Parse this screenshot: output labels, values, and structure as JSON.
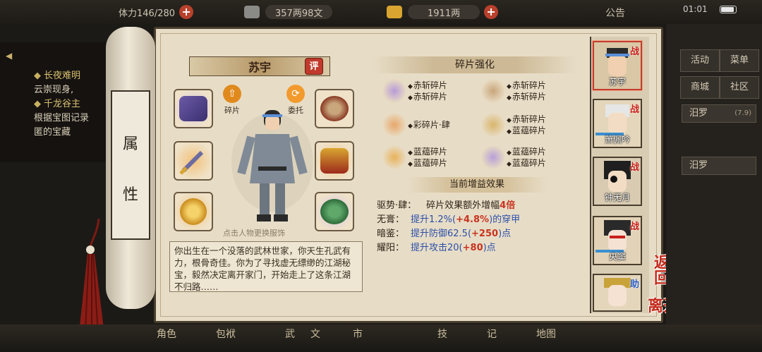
{
  "status_bar": {
    "stamina": "体力146/280",
    "silver": "357两98文",
    "gold": "1911两",
    "notice": "公告",
    "time": "01:01"
  },
  "quests": [
    {
      "title": "长夜难明",
      "desc": "云崇现身,"
    },
    {
      "title": "千龙谷主",
      "desc": "根据宝图记录",
      "desc2": "匿的宝藏"
    }
  ],
  "scroll_tab": {
    "chars": [
      "属",
      "性"
    ]
  },
  "character": {
    "name": "苏宇",
    "rate_button": "评",
    "hint": "点击人物更换服饰",
    "bio": "你出生在一个没落的武林世家，你天生孔武有力，根骨奇佳。你为了寻找虚无缥缈的江湖秘宝，毅然决定离开家门，开始走上了这条江湖不归路……"
  },
  "actions": [
    {
      "label": "碎片",
      "icon": "arrow-up-icon"
    },
    {
      "label": "委托",
      "icon": "refresh-icon"
    }
  ],
  "fragments": {
    "heading": "碎片强化",
    "items": [
      {
        "line1": "赤斩碎片",
        "line2": "赤斩碎片",
        "color": "#b79bd8"
      },
      {
        "line1": "赤斩碎片",
        "line2": "赤斩碎片",
        "color": "#c9a67c"
      },
      {
        "line1": "彩碎片·肆",
        "line2": "",
        "color": "#e7a76a"
      },
      {
        "line1": "赤斩碎片",
        "line2": "蓝蕴碎片",
        "color": "#d8b56c"
      },
      {
        "line1": "蓝蕴碎片",
        "line2": "蓝蕴碎片",
        "color": "#e8b25a"
      },
      {
        "line1": "蓝蕴碎片",
        "line2": "蓝蕴碎片",
        "color": "#b7a0d8"
      }
    ]
  },
  "buffs": {
    "heading": "当前增益效果",
    "rows": [
      {
        "name": "驱势·肆：",
        "text": "碎片效果额外增幅",
        "value": "4倍",
        "tail": ""
      },
      {
        "name": "无膏：",
        "text": "提升1.2%(",
        "value": "+4.8%",
        "tail": ")的穿甲"
      },
      {
        "name": "暗鉴：",
        "text": "提升防御62.5(",
        "value": "+250",
        "tail": ")点"
      },
      {
        "name": "耀阳：",
        "text": "提升攻击20(",
        "value": "+80",
        "tail": ")点"
      }
    ]
  },
  "portraits": [
    {
      "name": "苏宇",
      "tag": "战"
    },
    {
      "name": "萧佩吟",
      "tag": "战"
    },
    {
      "name": "钟无月",
      "tag": "战"
    },
    {
      "name": "央窦",
      "tag": "战"
    },
    {
      "name": "",
      "tag": "助"
    }
  ],
  "float_buttons": {
    "back": "返回",
    "leave": "离开"
  },
  "right_menu": {
    "buttons": [
      "活动",
      "菜单",
      "商城",
      "社区"
    ],
    "row1": {
      "label": "汨罗",
      "sub": "(7.9)"
    },
    "row2": {
      "label": "汨罗"
    }
  },
  "bottom_bar": {
    "items": [
      "角色",
      "包袱",
      "武",
      "文",
      "市",
      "技",
      "记",
      "地图"
    ]
  },
  "colors": {
    "accent": "#c0392b",
    "paper": "#e7ddc7",
    "blue_text": "#2d4fa8",
    "red_text": "#c8341f"
  }
}
